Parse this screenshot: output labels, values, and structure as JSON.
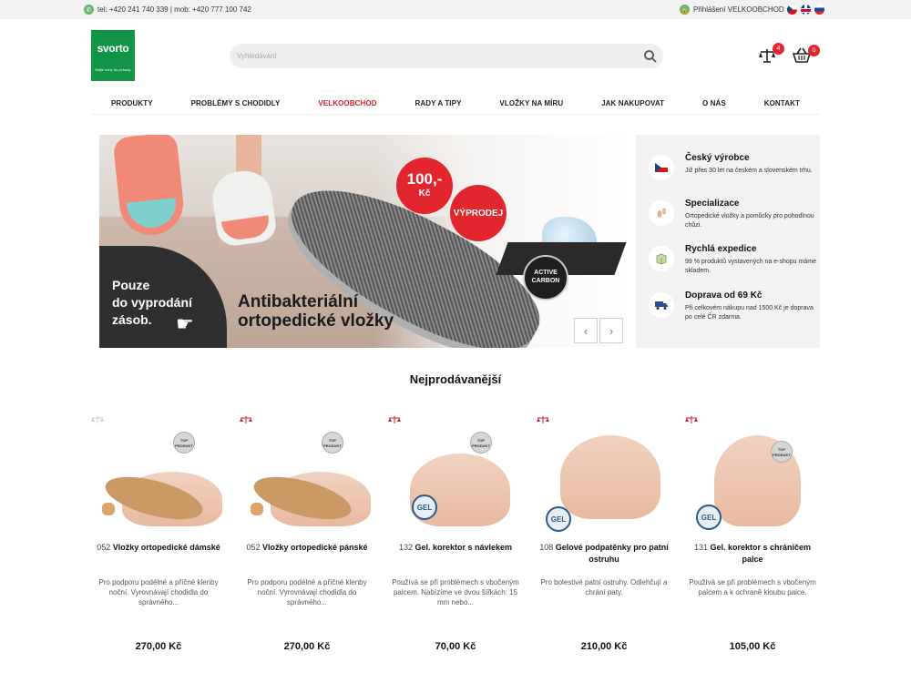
{
  "topbar": {
    "phone_text": "tel: +420 241 740 339 | mob: +420 777 100 742",
    "login_text": "Přihlášení VELKOOBCHOD",
    "languages": [
      "cz",
      "en",
      "sk"
    ]
  },
  "header": {
    "logo_text": "svorto",
    "logo_tagline": "Dejte nohy do pohody",
    "search_placeholder": "Vyhledávání",
    "compare_count": "4",
    "cart_count": "0"
  },
  "nav": {
    "items": [
      "PRODUKTY",
      "PROBLÉMY S CHODIDLY",
      "VELKOOBCHOD",
      "RADY A TIPY",
      "VLOŽKY NA MÍRU",
      "JAK NAKUPOVAT",
      "O NÁS",
      "KONTAKT"
    ],
    "active_index": 2,
    "active_color": "#d3202c"
  },
  "hero": {
    "price": "100,-",
    "currency": "Kč",
    "sale_label": "VÝPRODEJ",
    "carbon_label_1": "ACTIVE",
    "carbon_label_2": "CARBON",
    "promo_line_1": "Pouze",
    "promo_line_2": "do vyprodání",
    "promo_line_3": "zásob.",
    "title_line_1": "Antibakteriální",
    "title_line_2": "ortopedické vložky",
    "prev_icon": "‹",
    "next_icon": "›"
  },
  "benefits": [
    {
      "title": "Český výrobce",
      "text": "Již přes 30 let na českém a slovenském trhu.",
      "icon": "czech-flag-icon"
    },
    {
      "title": "Specializace",
      "text": "Ortopedické vložky a pomůcky pro pohodlnou chůzi.",
      "icon": "footprint-icon"
    },
    {
      "title": "Rychlá expedice",
      "text": "99 % produktů vystavených na e-shopu máme skladem.",
      "icon": "package-icon"
    },
    {
      "title": "Doprava od 69 Kč",
      "text": "Při celkovém nákupu nad 1500 Kč je doprava po celé ČR zdarma.",
      "icon": "truck-icon"
    }
  ],
  "section": {
    "bestsellers_title": "Nejprodávanější"
  },
  "products": [
    {
      "code": "052",
      "name": "Vložky ortopedické dámské",
      "desc": "Pro podporu podélné a příčné klenby noční. Vyrovnávají chodidla do správného...",
      "price": "270,00 Kč",
      "badge": "TOP PRODUKT"
    },
    {
      "code": "052",
      "name": "Vložky ortopedické pánské",
      "desc": "Pro podporu podélné a příčné klenby noční. Vyrovnávají chodidla do správného...",
      "price": "270,00 Kč",
      "badge": "TOP PRODUKT"
    },
    {
      "code": "132",
      "name": "Gel. korektor s návlekem",
      "desc": "Používá se při problémech s vbočeným palcem. Nabízíme ve dvou šířkách: 15 mm nebo...",
      "price": "70,00 Kč",
      "badge": "TOP PRODUKT"
    },
    {
      "code": "108",
      "name": "Gelové podpatěnky pro patní ostruhu",
      "desc": "Pro bolestivé patní ostruhy. Odlehčují a chrání paty.",
      "price": "210,00 Kč",
      "badge": ""
    },
    {
      "code": "131",
      "name": "Gel. korektor s chráničem palce",
      "desc": "Používá se při problémech s vbočeným palcem a k ochraně kloubu palce.",
      "price": "105,00 Kč",
      "badge": "TOP PRODUKT"
    }
  ],
  "colors": {
    "brand_green": "#129446",
    "accent_red": "#e3262e"
  }
}
